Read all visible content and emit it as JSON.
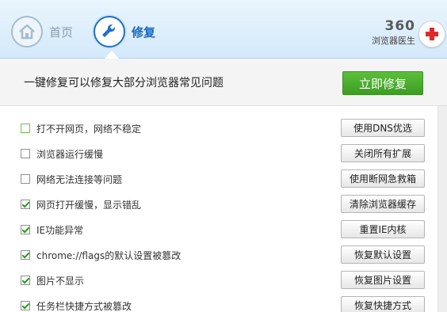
{
  "nav": {
    "home_label": "首页",
    "repair_label": "修复"
  },
  "brand": {
    "number": "360",
    "subtitle": "浏览器医生"
  },
  "banner": {
    "text": "一键修复可以修复大部分浏览器常见问题",
    "fix_button": "立即修复"
  },
  "problems": [
    {
      "label": "打不开网页，网络不稳定",
      "button": "使用DNS优选",
      "checked": false
    },
    {
      "label": "浏览器运行缓慢",
      "button": "关闭所有扩展",
      "checked": false
    },
    {
      "label": "网络无法连接等问题",
      "button": "使用断网急救箱",
      "checked": false
    },
    {
      "label": "网页打开缓慢，显示错乱",
      "button": "清除浏览器缓存",
      "checked": true
    },
    {
      "label": "IE功能异常",
      "button": "重置IE内核",
      "checked": true
    },
    {
      "label": "chrome://flags的默认设置被篡改",
      "button": "恢复默认设置",
      "checked": true
    },
    {
      "label": "图片不显示",
      "button": "恢复图片设置",
      "checked": true
    },
    {
      "label": "任务栏快捷方式被篡改",
      "button": "恢复快捷方式",
      "checked": true
    }
  ],
  "colors": {
    "accent_blue": "#1767c0",
    "fix_green": "#4caf2f",
    "check_green": "#2a9a1e"
  }
}
